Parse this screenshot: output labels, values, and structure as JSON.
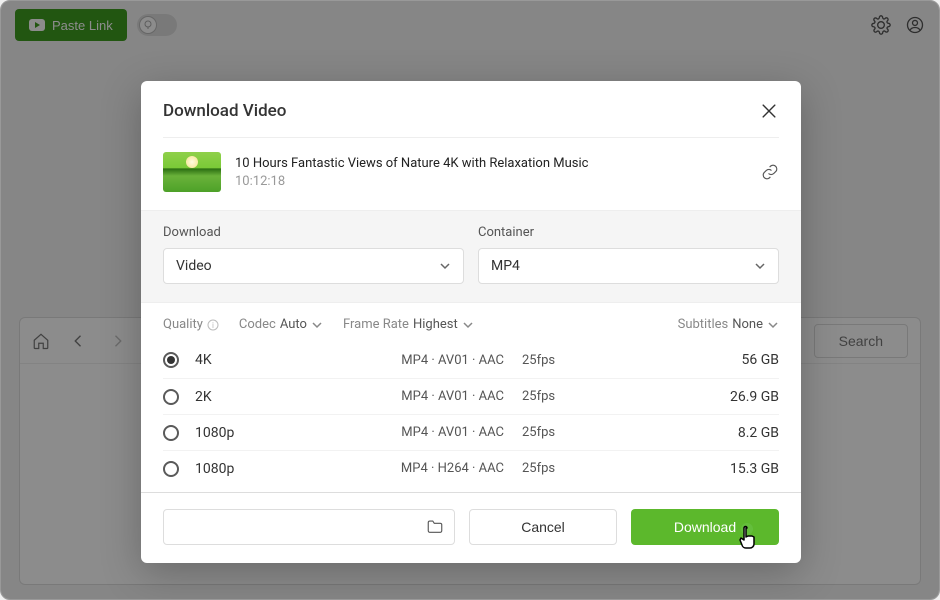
{
  "top_bar": {
    "paste_link": "Paste Link"
  },
  "search_label": "Search",
  "dialog": {
    "title": "Download Video",
    "video_title": "10 Hours Fantastic Views of Nature 4K with Relaxation Music",
    "duration": "10:12:18",
    "download_label": "Download",
    "download_value": "Video",
    "container_label": "Container",
    "container_value": "MP4",
    "quality_label": "Quality",
    "codec_label": "Codec",
    "codec_value": "Auto",
    "framerate_label": "Frame Rate",
    "framerate_value": "Highest",
    "subtitles_label": "Subtitles",
    "subtitles_value": "None",
    "rows": [
      {
        "label": "4K",
        "codec": "MP4 · AV01 · AAC",
        "fps": "25fps",
        "size": "56 GB",
        "selected": true
      },
      {
        "label": "2K",
        "codec": "MP4 · AV01 · AAC",
        "fps": "25fps",
        "size": "26.9 GB",
        "selected": false
      },
      {
        "label": "1080p",
        "codec": "MP4 · AV01 · AAC",
        "fps": "25fps",
        "size": "8.2 GB",
        "selected": false
      },
      {
        "label": "1080p",
        "codec": "MP4 · H264 · AAC",
        "fps": "25fps",
        "size": "15.3 GB",
        "selected": false
      }
    ],
    "cancel_label": "Cancel",
    "download_button": "Download"
  }
}
